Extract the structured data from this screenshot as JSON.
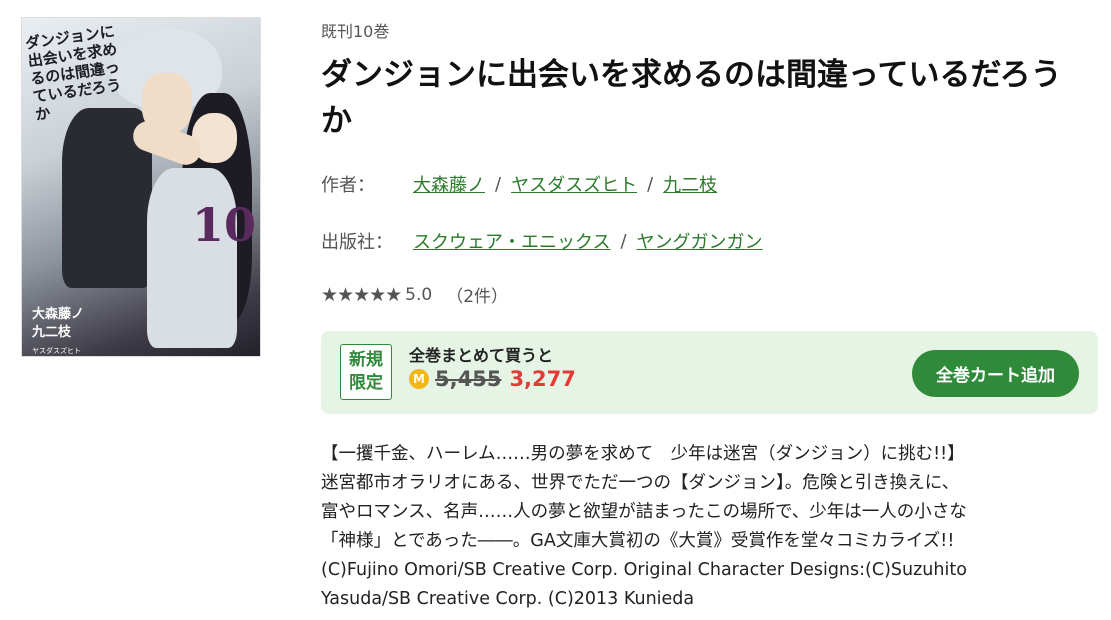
{
  "book": {
    "volume_count": "既刊10巻",
    "title": "ダンジョンに出会いを求めるのは間違っているだろうか",
    "cover": {
      "title_text": "ダンジョンに出会いを求めるのは間違っているだろうか",
      "volume_number": "10",
      "credit_author": "大森藤ノ",
      "credit_artist": "九二枝",
      "credit_character": "ヤスダスズヒト"
    }
  },
  "meta": {
    "author_label": "作者：",
    "authors": [
      "大森藤ノ",
      "ヤスダスズヒト",
      "九二枝"
    ],
    "separator": "/",
    "publisher_label": "出版社：",
    "publishers": [
      "スクウェア・エニックス",
      "ヤングガンガン"
    ]
  },
  "rating": {
    "stars": "★★★★★",
    "score": "5.0",
    "count": "（2件）"
  },
  "promo": {
    "badge_line1": "新規",
    "badge_line2": "限定",
    "headline": "全巻まとめて買うと",
    "coin_icon": "M",
    "old_price": "5,455",
    "new_price": "3,277",
    "cart_button": "全巻カート追加",
    "accent_color": "#2f8a3a",
    "price_color": "#e53935"
  },
  "description": [
    "【一攫千金、ハーレム……男の夢を求めて　少年は迷宮（ダンジョン）に挑む!!】",
    "迷宮都市オラリオにある、世界でただ一つの【ダンジョン】。危険と引き換えに、",
    "富やロマンス、名声……人の夢と欲望が詰まったこの場所で、少年は一人の小さな",
    "「神様」とであった――。GA文庫大賞初の《大賞》受賞作を堂々コミカライズ!!",
    "(C)Fujino Omori/SB Creative Corp. Original Character Designs:(C)Suzuhito",
    "Yasuda/SB Creative Corp. (C)2013 Kunieda"
  ]
}
